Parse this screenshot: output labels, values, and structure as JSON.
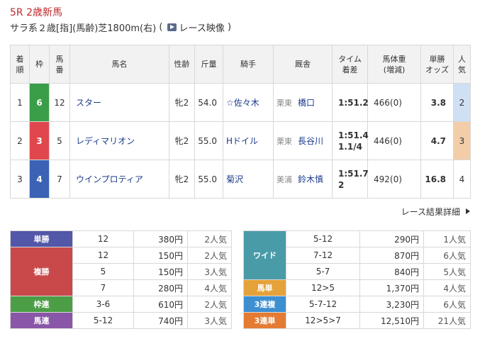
{
  "race": {
    "title": "5R 2歳新馬",
    "meta": "サラ系２歳[指](馬齢)芝1800m(右)",
    "video_label": "レース映像"
  },
  "headers": [
    "着順",
    "枠",
    "馬番",
    "馬名",
    "性齢",
    "斤量",
    "騎手",
    "厩舎",
    "タイム着差",
    "馬体重(増減)",
    "単勝オッズ",
    "人気"
  ],
  "header_lines": {
    "rank": [
      "着",
      "順"
    ],
    "gate": [
      "枠"
    ],
    "num": [
      "馬",
      "番"
    ],
    "name": [
      "馬名"
    ],
    "sex": [
      "性齢"
    ],
    "futan": [
      "斤量"
    ],
    "jockey": [
      "騎手"
    ],
    "stable": [
      "厩舎"
    ],
    "time": [
      "タイム",
      "着差"
    ],
    "weight": [
      "馬体重",
      "(増減)"
    ],
    "odds": [
      "単勝",
      "オッズ"
    ],
    "pop": [
      "人",
      "気"
    ]
  },
  "rows": [
    {
      "rank": "1",
      "gate": "6",
      "gate_color": "#3a9e48",
      "num": "12",
      "name": "スター",
      "sex": "牝2",
      "futan": "54.0",
      "jockey": "☆佐々木",
      "region": "栗東",
      "trainer": "橋口",
      "time": "1:51.2",
      "margin": "",
      "weight": "466(0)",
      "odds": "3.8",
      "pop": "2",
      "pop_bg": "#cfe0f5"
    },
    {
      "rank": "2",
      "gate": "3",
      "gate_color": "#e0474c",
      "num": "5",
      "name": "レディマリオン",
      "sex": "牝2",
      "futan": "55.0",
      "jockey": "Hドイル",
      "region": "栗東",
      "trainer": "長谷川",
      "time": "1:51.4",
      "margin": "1.1/4",
      "weight": "446(0)",
      "odds": "4.7",
      "pop": "3",
      "pop_bg": "#f2cda8"
    },
    {
      "rank": "3",
      "gate": "4",
      "gate_color": "#3b62b5",
      "num": "7",
      "name": "ウインプロティア",
      "sex": "牝2",
      "futan": "55.0",
      "jockey": "菊沢",
      "region": "美浦",
      "trainer": "鈴木慎",
      "time": "1:51.7",
      "margin": "2",
      "weight": "492(0)",
      "odds": "16.8",
      "pop": "4",
      "pop_bg": ""
    }
  ],
  "detail_link": "レース結果詳細",
  "payout_left": [
    {
      "label": "単勝",
      "color": "#5257a8",
      "entries": [
        {
          "combo": "12",
          "amount": "380円",
          "pop": "2人気"
        }
      ]
    },
    {
      "label": "複勝",
      "color": "#c9494b",
      "entries": [
        {
          "combo": "12",
          "amount": "150円",
          "pop": "2人気"
        },
        {
          "combo": "5",
          "amount": "150円",
          "pop": "3人気"
        },
        {
          "combo": "7",
          "amount": "280円",
          "pop": "4人気"
        }
      ]
    },
    {
      "label": "枠連",
      "color": "#4c9e46",
      "entries": [
        {
          "combo": "3-6",
          "amount": "610円",
          "pop": "2人気"
        }
      ]
    },
    {
      "label": "馬連",
      "color": "#8a56a8",
      "entries": [
        {
          "combo": "5-12",
          "amount": "740円",
          "pop": "3人気"
        }
      ]
    }
  ],
  "payout_right": [
    {
      "label": "ワイド",
      "color": "#4a9ba8",
      "entries": [
        {
          "combo": "5-12",
          "amount": "290円",
          "pop": "1人気"
        },
        {
          "combo": "7-12",
          "amount": "870円",
          "pop": "6人気"
        },
        {
          "combo": "5-7",
          "amount": "840円",
          "pop": "5人気"
        }
      ]
    },
    {
      "label": "馬単",
      "color": "#e5a23a",
      "entries": [
        {
          "combo": "12>5",
          "amount": "1,370円",
          "pop": "4人気"
        }
      ]
    },
    {
      "label": "3連複",
      "color": "#3d8fd1",
      "entries": [
        {
          "combo": "5-7-12",
          "amount": "3,230円",
          "pop": "6人気"
        }
      ]
    },
    {
      "label": "3連単",
      "color": "#e47b33",
      "entries": [
        {
          "combo": "12>5>7",
          "amount": "12,510円",
          "pop": "21人気"
        }
      ]
    }
  ]
}
